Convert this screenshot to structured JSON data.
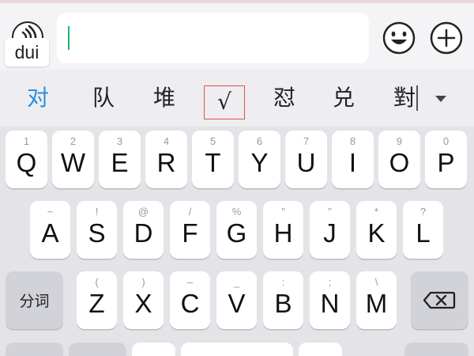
{
  "input_bar": {
    "voice_icon": "voice-input-icon",
    "text_value": "",
    "emoji_icon": "smiley-face-icon",
    "plus_icon": "plus-circle-icon",
    "caret_color": "#1db86a"
  },
  "pinyin": {
    "text": "dui"
  },
  "candidates": {
    "items": [
      "对",
      "队",
      "堆",
      "√",
      "怼",
      "兑",
      "對"
    ],
    "active_color": "#2b8fe0",
    "highlight_border": "#e05244",
    "expand_icon": "triangle-down-icon"
  },
  "keyboard": {
    "row1": [
      {
        "hint": "1",
        "key": "Q"
      },
      {
        "hint": "2",
        "key": "W"
      },
      {
        "hint": "3",
        "key": "E"
      },
      {
        "hint": "4",
        "key": "R"
      },
      {
        "hint": "5",
        "key": "T"
      },
      {
        "hint": "6",
        "key": "Y"
      },
      {
        "hint": "7",
        "key": "U"
      },
      {
        "hint": "8",
        "key": "I"
      },
      {
        "hint": "9",
        "key": "O"
      },
      {
        "hint": "0",
        "key": "P"
      }
    ],
    "row2": [
      {
        "hint": "~",
        "key": "A"
      },
      {
        "hint": "!",
        "key": "S"
      },
      {
        "hint": "@",
        "key": "D"
      },
      {
        "hint": "/",
        "key": "F"
      },
      {
        "hint": "%",
        "key": "G"
      },
      {
        "hint": "\"",
        "key": "H"
      },
      {
        "hint": "\"",
        "key": "J"
      },
      {
        "hint": "*",
        "key": "K"
      },
      {
        "hint": "?",
        "key": "L"
      }
    ],
    "row3": [
      {
        "hint": "(",
        "key": "Z"
      },
      {
        "hint": ")",
        "key": "X"
      },
      {
        "hint": "–",
        "key": "C"
      },
      {
        "hint": "_",
        "key": "V"
      },
      {
        "hint": ":",
        "key": "B"
      },
      {
        "hint": ";",
        "key": "N"
      },
      {
        "hint": "\\",
        "key": "M"
      }
    ],
    "segment_label": "分词",
    "backspace_icon": "backspace-icon"
  }
}
